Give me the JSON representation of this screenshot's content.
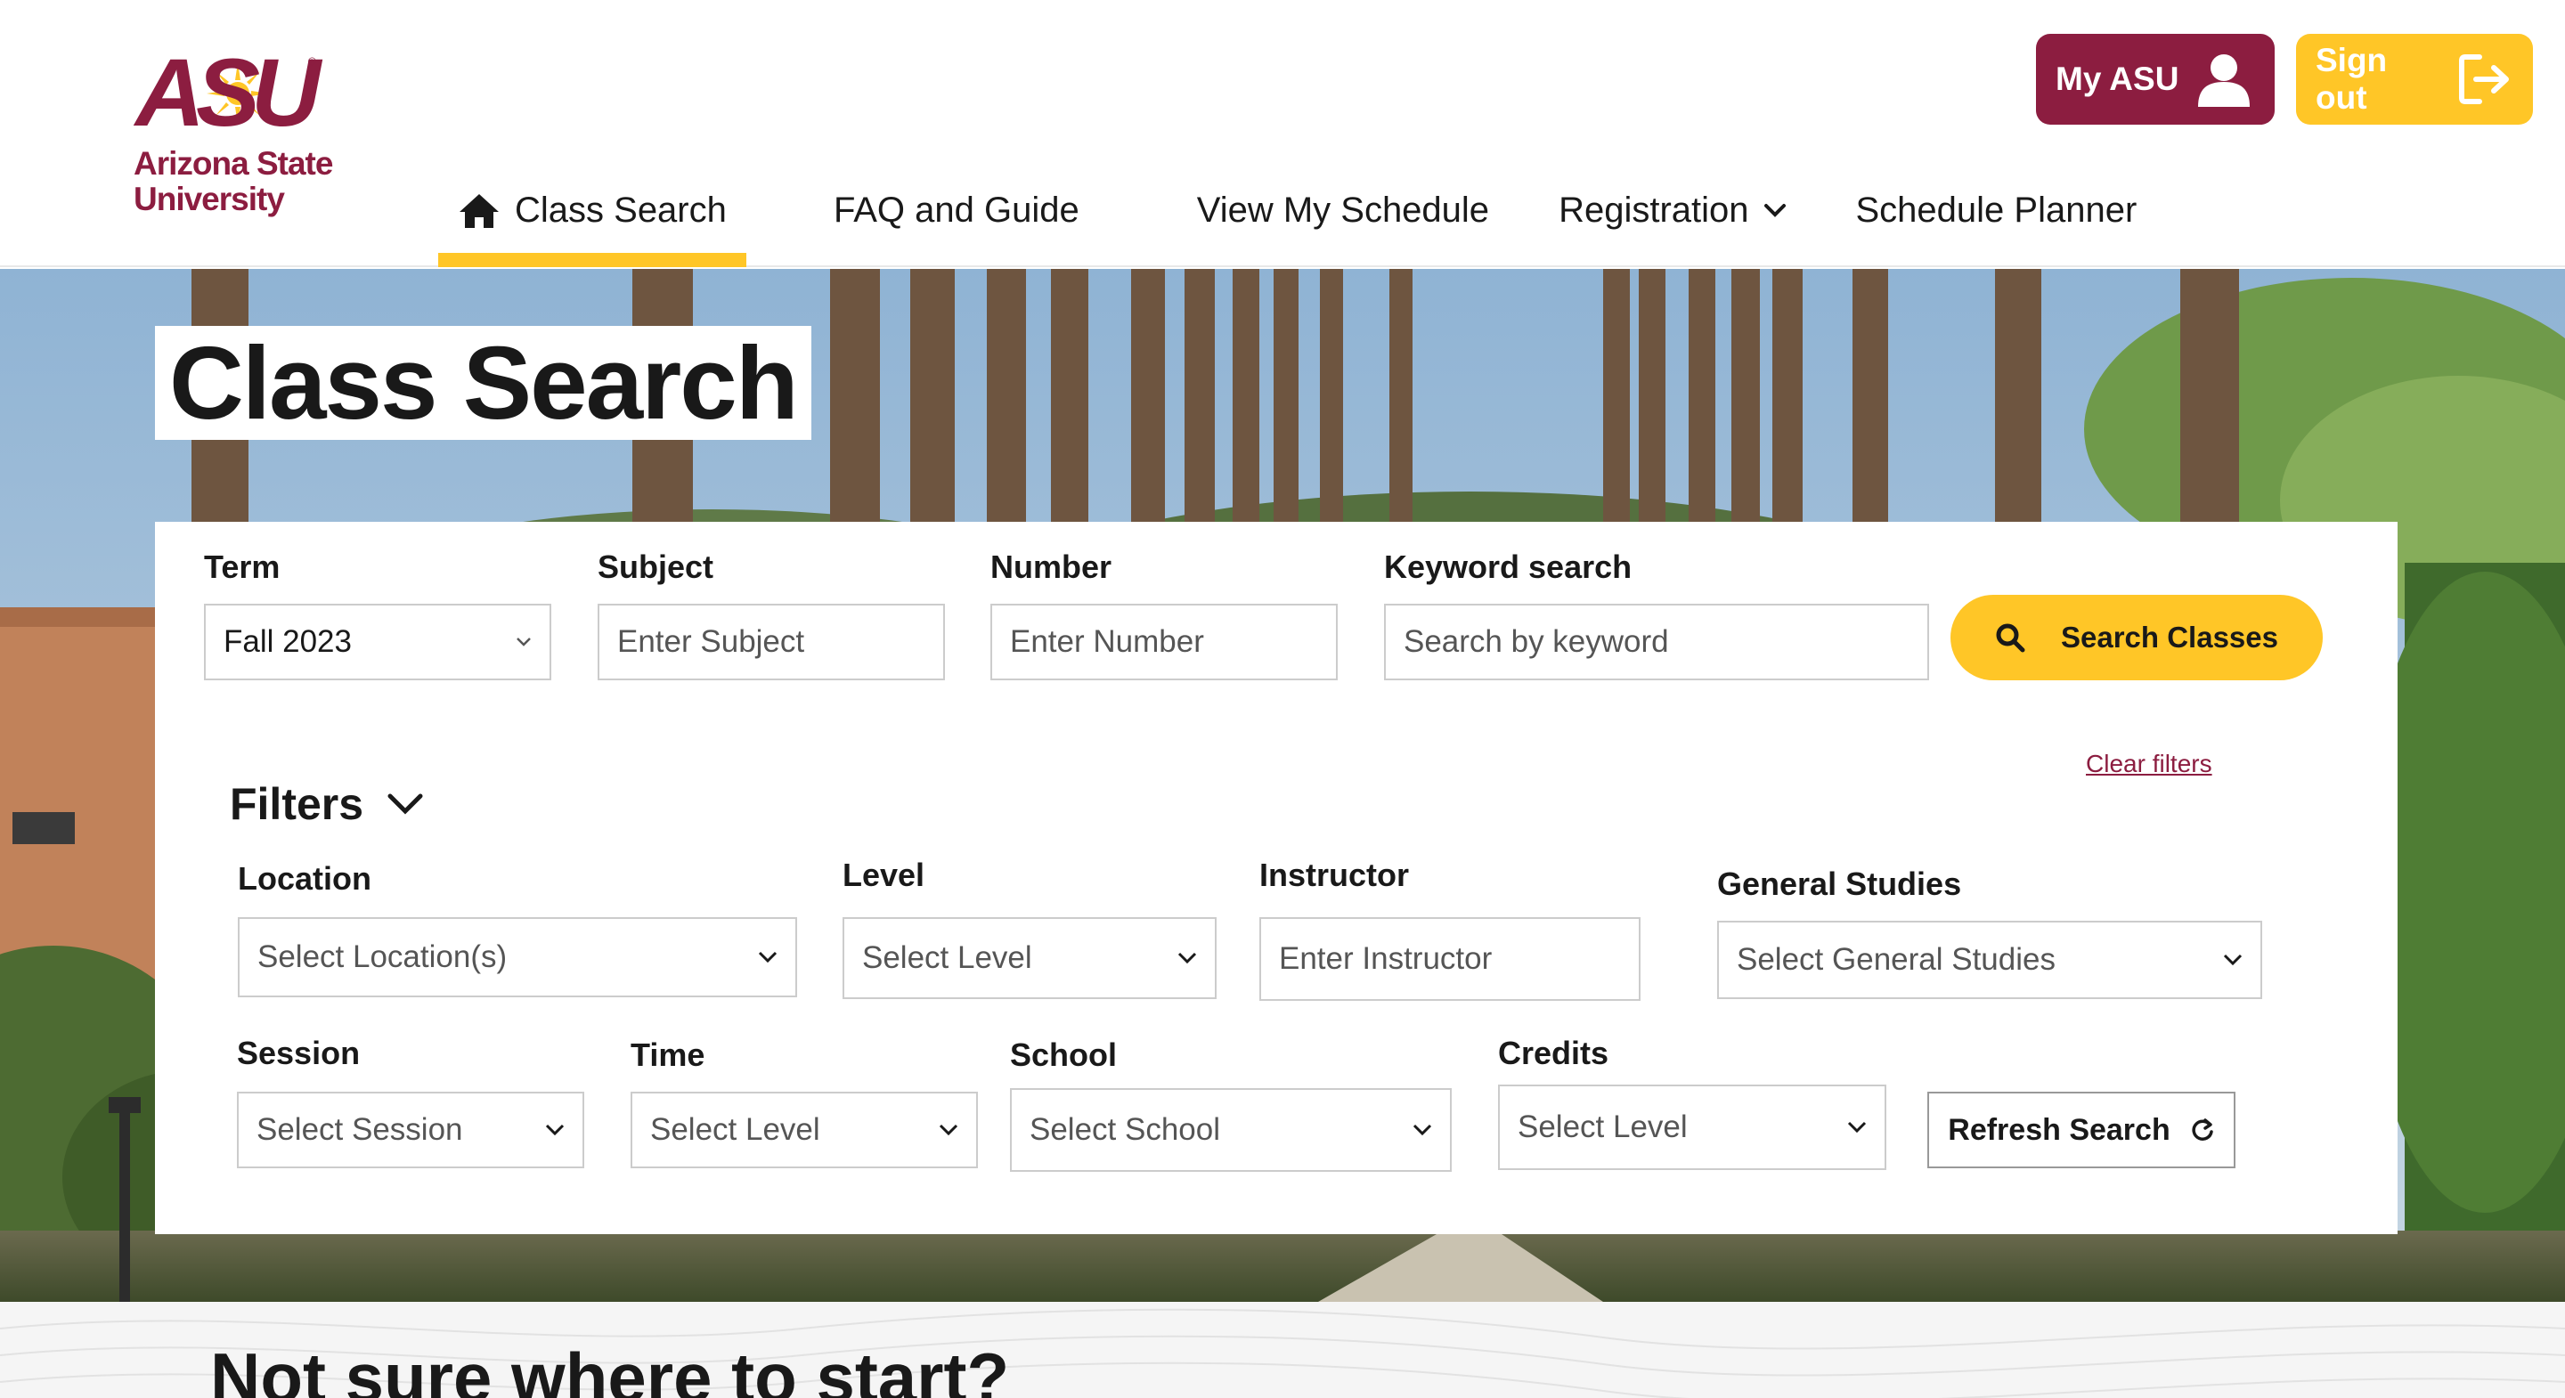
{
  "brand": {
    "mark": "ASU",
    "name": "Arizona State\nUniversity",
    "primary_color": "#8c1d40",
    "gold_color": "#ffc627"
  },
  "header_buttons": {
    "my_asu": {
      "label": "My ASU",
      "icon": "user-icon"
    },
    "sign_out": {
      "label": "Sign out",
      "icon": "sign-out-icon"
    }
  },
  "nav": {
    "items": [
      {
        "label": "Class Search",
        "icon": "home-icon",
        "active": true
      },
      {
        "label": "FAQ and Guide"
      },
      {
        "label": "View My Schedule"
      },
      {
        "label": "Registration",
        "icon": "chevron-down-icon"
      },
      {
        "label": "Schedule Planner"
      }
    ]
  },
  "hero": {
    "title": "Class Search"
  },
  "search": {
    "term": {
      "label": "Term",
      "value": "Fall 2023"
    },
    "subject": {
      "label": "Subject",
      "placeholder": "Enter Subject"
    },
    "number": {
      "label": "Number",
      "placeholder": "Enter Number"
    },
    "keyword": {
      "label": "Keyword search",
      "placeholder": "Search by keyword"
    },
    "submit_label": "Search Classes"
  },
  "filters": {
    "title": "Filters",
    "clear_label": "Clear filters",
    "location": {
      "label": "Location",
      "value": "Select Location(s)"
    },
    "level": {
      "label": "Level",
      "value": "Select Level"
    },
    "instructor": {
      "label": "Instructor",
      "placeholder": "Enter Instructor"
    },
    "general_studies": {
      "label": "General Studies",
      "value": "Select General Studies"
    },
    "session": {
      "label": "Session",
      "value": "Select Session"
    },
    "time": {
      "label": "Time",
      "value": "Select Level"
    },
    "school": {
      "label": "School",
      "value": "Select School"
    },
    "credits": {
      "label": "Credits",
      "value": "Select Level"
    },
    "refresh_label": "Refresh Search"
  },
  "bottom": {
    "heading": "Not sure where to start?"
  }
}
